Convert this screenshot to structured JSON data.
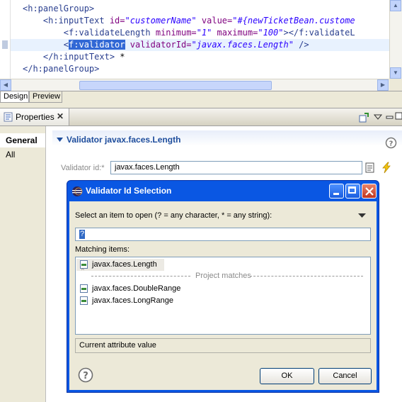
{
  "editor": {
    "lines": [
      {
        "indent": "",
        "parts": [
          {
            "t": "<h:panelGroup>",
            "c": "tag"
          }
        ]
      },
      {
        "indent": "    ",
        "parts": [
          {
            "t": "<h:inputText ",
            "c": "tag"
          },
          {
            "t": "id=",
            "c": "attr"
          },
          {
            "t": "\"customerName\"",
            "c": "str"
          },
          {
            "t": " value=",
            "c": "attr"
          },
          {
            "t": "\"#{newTicketBean.custome",
            "c": "str"
          }
        ]
      },
      {
        "indent": "        ",
        "parts": [
          {
            "t": "<f:validateLength ",
            "c": "tag"
          },
          {
            "t": "minimum=",
            "c": "attr"
          },
          {
            "t": "\"1\"",
            "c": "str"
          },
          {
            "t": " maximum=",
            "c": "attr"
          },
          {
            "t": "\"100\"",
            "c": "str"
          },
          {
            "t": "></f:validateL",
            "c": "tag"
          }
        ]
      },
      {
        "indent": "        ",
        "parts": [
          {
            "t": "<",
            "c": "tag"
          },
          {
            "t": "f:validator",
            "c": "sel"
          },
          {
            "t": " validatorId=",
            "c": "attr"
          },
          {
            "t": "\"javax.faces.Length\"",
            "c": "str"
          },
          {
            "t": " />",
            "c": "tag"
          }
        ]
      },
      {
        "indent": "    ",
        "parts": [
          {
            "t": "</h:inputText>",
            "c": "tag"
          },
          {
            "t": " *",
            "c": ""
          }
        ]
      },
      {
        "indent": "",
        "parts": [
          {
            "t": "</h:panelGroup>",
            "c": "tag"
          }
        ]
      }
    ],
    "tabs": [
      "Design",
      "Preview"
    ]
  },
  "properties": {
    "view_title": "Properties",
    "view_close": "✕",
    "left_tabs": [
      "General",
      "All"
    ],
    "section_title": "Validator javax.faces.Length",
    "validator_id_label": "Validator id:*",
    "validator_id_value": "javax.faces.Length",
    "help": "?"
  },
  "dialog": {
    "title": "Validator Id Selection",
    "prompt": "Select an item to open (? = any character, * = any string):",
    "filter_value": "?",
    "matching_label": "Matching items:",
    "items": [
      "javax.faces.Length",
      "javax.faces.DoubleRange",
      "javax.faces.LongRange"
    ],
    "separator_label": "Project matches",
    "status": "Current attribute value",
    "ok_label": "OK",
    "cancel_label": "Cancel",
    "help": "?"
  }
}
